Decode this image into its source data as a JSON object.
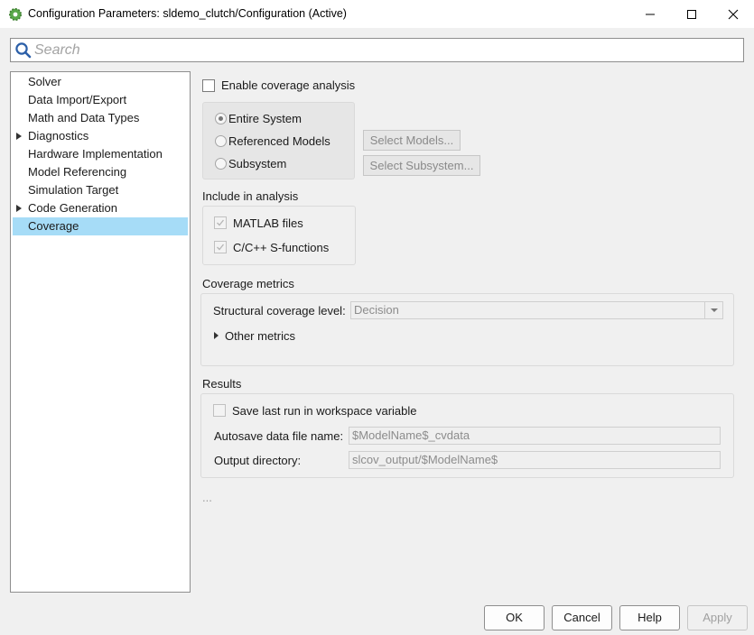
{
  "window": {
    "title": "Configuration Parameters: sldemo_clutch/Configuration (Active)",
    "controls": [
      "minimize-icon",
      "maximize-icon",
      "close-icon"
    ]
  },
  "search": {
    "placeholder": "Search",
    "value": ""
  },
  "nav": {
    "items": [
      {
        "label": "Solver",
        "expandable": false,
        "selected": false
      },
      {
        "label": "Data Import/Export",
        "expandable": false,
        "selected": false
      },
      {
        "label": "Math and Data Types",
        "expandable": false,
        "selected": false
      },
      {
        "label": "Diagnostics",
        "expandable": true,
        "selected": false
      },
      {
        "label": "Hardware Implementation",
        "expandable": false,
        "selected": false
      },
      {
        "label": "Model Referencing",
        "expandable": false,
        "selected": false
      },
      {
        "label": "Simulation Target",
        "expandable": false,
        "selected": false
      },
      {
        "label": "Code Generation",
        "expandable": true,
        "selected": false
      },
      {
        "label": "Coverage",
        "expandable": false,
        "selected": true
      }
    ]
  },
  "coverage": {
    "enable_label": "Enable coverage analysis",
    "enable_checked": false,
    "scope": {
      "options": [
        "Entire System",
        "Referenced Models",
        "Subsystem"
      ],
      "selected": "Entire System",
      "select_models_label": "Select Models...",
      "select_subsystem_label": "Select Subsystem..."
    },
    "include": {
      "title": "Include in analysis",
      "matlab_files_label": "MATLAB files",
      "matlab_files_checked": true,
      "sfunctions_label": "C/C++ S-functions",
      "sfunctions_checked": true
    },
    "metrics": {
      "title": "Coverage metrics",
      "structural_label": "Structural coverage level:",
      "structural_value": "Decision",
      "other_metrics_label": "Other metrics"
    },
    "results": {
      "title": "Results",
      "save_last_run_label": "Save last run in workspace variable",
      "save_last_run_checked": false,
      "autosave_label": "Autosave data file name:",
      "autosave_value": "$ModelName$_cvdata",
      "output_dir_label": "Output directory:",
      "output_dir_value": "slcov_output/$ModelName$"
    },
    "more": "..."
  },
  "footer": {
    "ok": "OK",
    "cancel": "Cancel",
    "help": "Help",
    "apply": "Apply"
  },
  "colors": {
    "selection": "#a6dcf7",
    "background": "#f0f0f0",
    "shaded_group": "#e6e6e6"
  }
}
